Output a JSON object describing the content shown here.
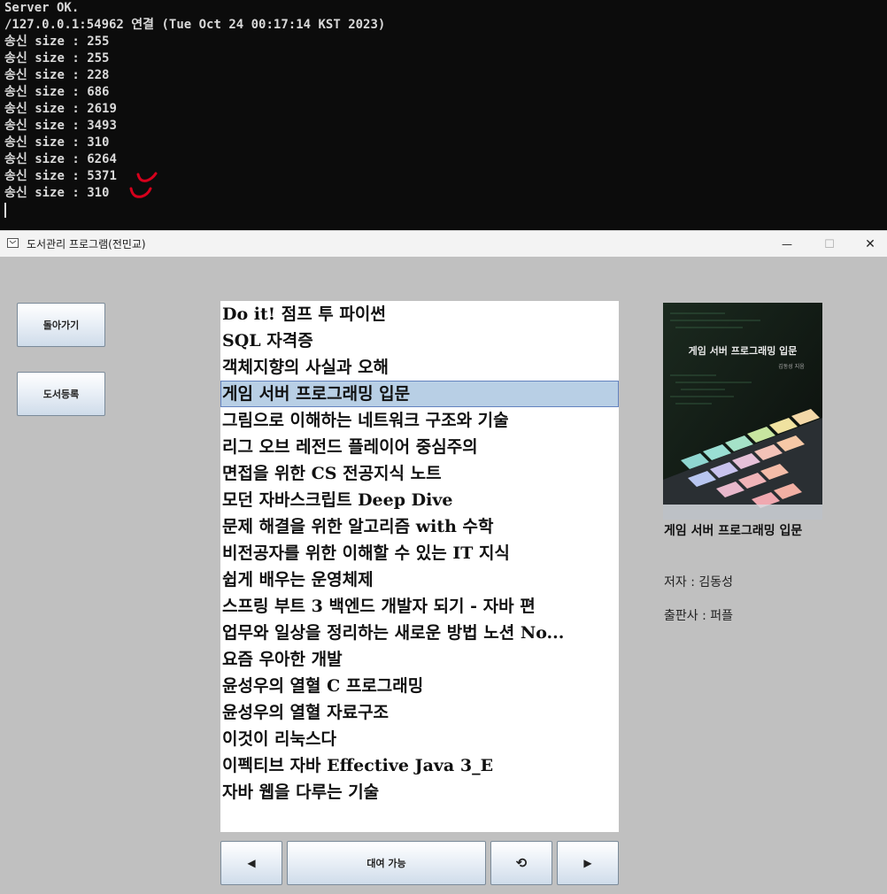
{
  "console": {
    "lines": [
      "Server OK.",
      "/127.0.0.1:54962 연결 (Tue Oct 24 00:17:14 KST 2023)",
      "송신 size : 255",
      "송신 size : 255",
      "송신 size : 228",
      "송신 size : 686",
      "송신 size : 2619",
      "송신 size : 3493",
      "송신 size : 310",
      "송신 size : 6264",
      "송신 size : 5371",
      "송신 size : 310"
    ]
  },
  "window": {
    "title": "도서관리 프로그램(전민교)",
    "minimize_symbol": "—",
    "maximize_symbol": "☐",
    "close_symbol": "✕"
  },
  "sidebar": {
    "back_label": "돌아가기",
    "register_label": "도서등록"
  },
  "book_list": {
    "selected_index": 3,
    "items": [
      "Do it! 점프 투 파이썬",
      "SQL 자격증",
      "객체지향의 사실과 오해",
      "게임 서버 프로그래밍 입문",
      "그림으로 이해하는 네트워크 구조와 기술",
      "리그 오브 레전드 플레이어 중심주의",
      "면접을 위한 CS 전공지식 노트",
      "모던 자바스크립트 Deep Dive",
      "문제 해결을 위한 알고리즘 with 수학",
      "비전공자를 위한 이해할 수 있는 IT 지식",
      "쉽게 배우는 운영체제",
      "스프링 부트 3 백엔드 개발자 되기 - 자바 편",
      "업무와 일상을 정리하는 새로운 방법 노션 No...",
      "요즘 우아한 개발",
      "윤성우의 열혈 C 프로그래밍",
      "윤성우의 열혈 자료구조",
      "이것이 리눅스다",
      "이펙티브 자바 Effective Java 3_E",
      "자바 웹을 다루는 기술"
    ]
  },
  "controls": {
    "prev_symbol": "◀",
    "status_label": "대여 가능",
    "refresh_symbol": "⟲",
    "next_symbol": "▶"
  },
  "detail": {
    "cover_title": "게임 서버 프로그래밍 입문",
    "cover_author": "김동성 지음",
    "title": "게임 서버 프로그래밍 입문",
    "author": "저자 : 김동성",
    "publisher": "출판사 : 퍼플"
  },
  "colors": {
    "console_bg": "#0c0c0c",
    "window_bg": "#c0c0c0",
    "selection": "#b8cfe5",
    "annotation": "#d6001c"
  }
}
